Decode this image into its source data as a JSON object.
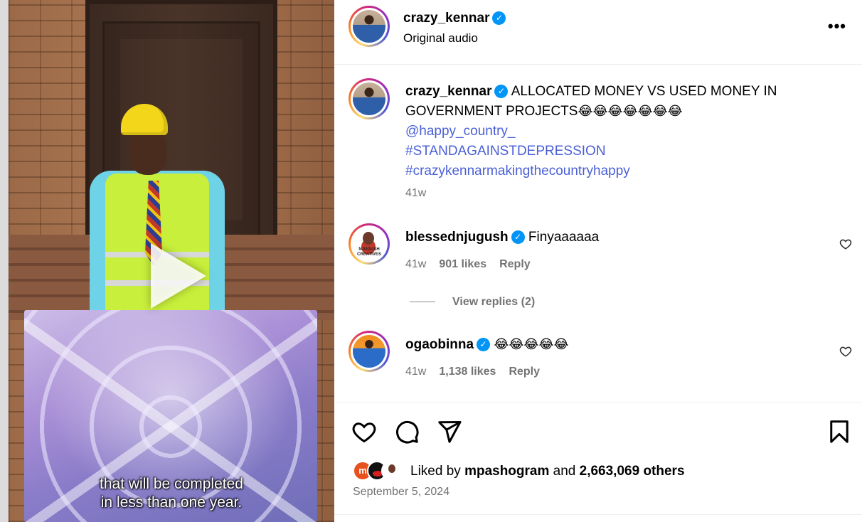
{
  "post": {
    "username": "crazy_kennar",
    "audio": "Original audio",
    "video_caption_line1": "that will be completed",
    "video_caption_line2": "in less than one year."
  },
  "caption": {
    "username": "crazy_kennar",
    "text": "ALLOCATED MONEY VS USED MONEY IN GOVERNMENT PROJECTS",
    "emojis": "😂😂😂😂😂😂😂",
    "mention": "@happy_country_",
    "hashtag1": "#STANDAGAINSTDEPRESSION",
    "hashtag2": "#crazykennarmakingthecountryhappy",
    "age": "41w"
  },
  "comments": [
    {
      "username": "blessednjugush",
      "text": "Finyaaaaaa",
      "age": "41w",
      "likes": "901 likes",
      "reply": "Reply",
      "avatar_tag": "NJUGUSH CREATIVES"
    },
    {
      "username": "ogaobinna",
      "text": "😂😂😂😂😂",
      "age": "41w",
      "likes": "1,138 likes",
      "reply": "Reply"
    }
  ],
  "view_replies": "View replies (2)",
  "likes": {
    "prefix": "Liked by",
    "user": "mpashogram",
    "joiner": "and",
    "others": "2,663,069 others"
  },
  "date": "September 5, 2024",
  "icons": {
    "verified": "verified-badge-icon",
    "more": "more-options-icon",
    "like": "heart-icon",
    "comment": "comment-bubble-icon",
    "share": "paper-plane-icon",
    "save": "bookmark-icon",
    "play": "play-icon"
  },
  "colors": {
    "link": "#4a5fd6",
    "verified": "#0095f6",
    "muted": "#737373"
  }
}
